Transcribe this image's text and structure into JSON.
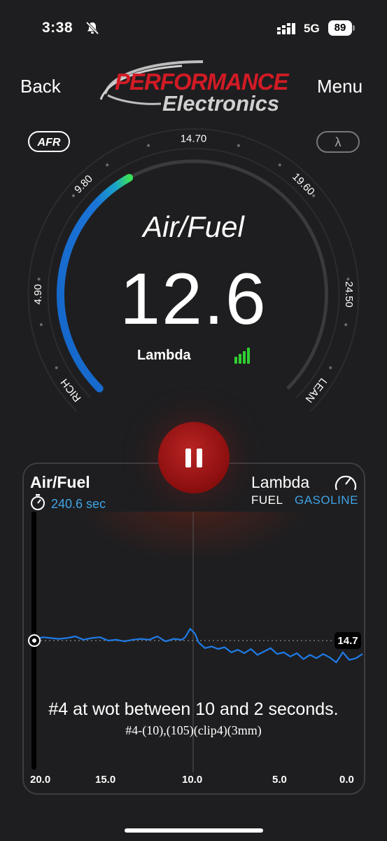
{
  "status_bar": {
    "time": "3:38",
    "network": "5G",
    "battery": "89"
  },
  "nav": {
    "back_label": "Back",
    "menu_label": "Menu",
    "brand_line1": "PERFORMANCE",
    "brand_line2": "Electronics"
  },
  "gauge": {
    "afr_button": "AFR",
    "lambda_button": "λ",
    "scale_labels": [
      "4.90",
      "9.80",
      "14.70",
      "19.60",
      "24.50"
    ],
    "rich_label": "RICH",
    "lean_label": "LEAN",
    "title": "Air/Fuel",
    "value": "12.6",
    "unit_label": "Lambda",
    "scale_min": 4.9,
    "scale_max": 24.5
  },
  "panel": {
    "title": "Air/Fuel",
    "timer": "240.6 sec",
    "lambda_label": "Lambda",
    "fuel_label": "FUEL",
    "fuel_value": "GASOLINE",
    "reference_value": "14.7",
    "note_line1": "#4 at wot between 10 and 2 seconds.",
    "note_line2": "#4-(10),(105)(clip4)(3mm)",
    "x_axis_labels": [
      "20.0",
      "15.0",
      "10.0",
      "5.0",
      "0.0"
    ]
  },
  "colors": {
    "accent_blue": "#3fa4e6",
    "pause_red": "#a51818",
    "signal_green": "#2fd12f",
    "background": "#1e1e20"
  },
  "chart_data": {
    "type": "line",
    "x_reversed": true,
    "xlim": [
      20,
      0
    ],
    "reference_line": 14.7,
    "x": [
      20,
      19.5,
      19,
      18.5,
      18,
      17.5,
      17,
      16.5,
      16,
      15.5,
      15,
      14.5,
      14,
      13.5,
      13,
      12.5,
      12,
      11.5,
      11,
      10.8,
      10.5,
      10.2,
      10,
      9.6,
      9.2,
      8.8,
      8.4,
      8,
      7.6,
      7.2,
      6.8,
      6.4,
      6,
      5.6,
      5.2,
      4.8,
      4.4,
      4,
      3.6,
      3.2,
      2.8,
      2.4,
      2,
      1.6,
      1.2,
      0.8,
      0.4,
      0
    ],
    "y": [
      14.7,
      14.3,
      14.4,
      14.5,
      14.4,
      14.2,
      14.6,
      14.4,
      14.3,
      14.7,
      14.6,
      14.8,
      14.6,
      14.5,
      14.6,
      14.2,
      14.8,
      14.5,
      14.6,
      14.3,
      13.3,
      13.9,
      14.9,
      15.6,
      15.4,
      15.7,
      15.5,
      16.1,
      15.8,
      16.2,
      15.7,
      16.4,
      16.0,
      15.6,
      16.3,
      16.1,
      16.6,
      16.2,
      16.9,
      16.4,
      16.8,
      16.3,
      16.7,
      17.3,
      16.1,
      17.0,
      16.8,
      16.3
    ]
  }
}
